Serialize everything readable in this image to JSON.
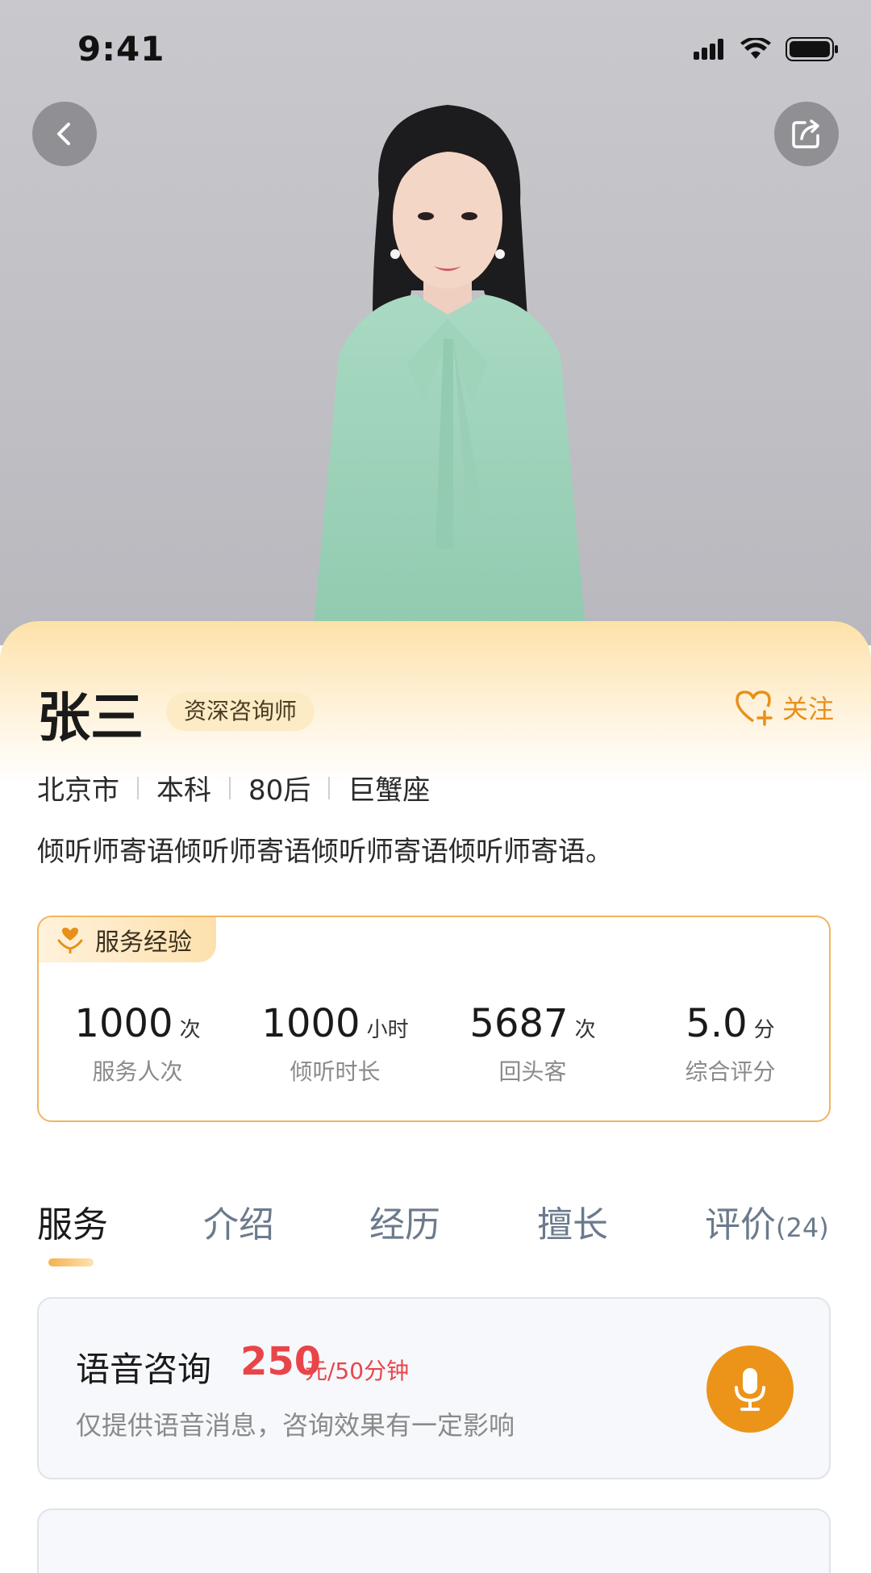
{
  "status_bar": {
    "time": "9:41"
  },
  "profile": {
    "name": "张三",
    "title_badge": "资深咨询师",
    "follow_label": "关注",
    "meta": [
      "北京市",
      "本科",
      "80后",
      "巨蟹座"
    ],
    "bio": "倾听师寄语倾听师寄语倾听师寄语倾听师寄语。"
  },
  "experience": {
    "tag_label": "服务经验",
    "stats": [
      {
        "value": "1000",
        "unit": "次",
        "label": "服务人次"
      },
      {
        "value": "1000",
        "unit": "小时",
        "label": "倾听时长"
      },
      {
        "value": "5687",
        "unit": "次",
        "label": "回头客"
      },
      {
        "value": "5.0",
        "unit": "分",
        "label": "综合评分"
      }
    ]
  },
  "tabs": [
    {
      "label": "服务",
      "active": true
    },
    {
      "label": "介绍"
    },
    {
      "label": "经历"
    },
    {
      "label": "擅长"
    },
    {
      "label": "评价",
      "count": "(24)"
    }
  ],
  "services": [
    {
      "name": "语音咨询",
      "price": "250",
      "unit": "元/50分钟",
      "description": "仅提供语音消息，咨询效果有一定影响"
    }
  ],
  "colors": {
    "accent": "#ec9419",
    "price": "#e8454a",
    "tab_inactive": "#6b7a8c"
  }
}
